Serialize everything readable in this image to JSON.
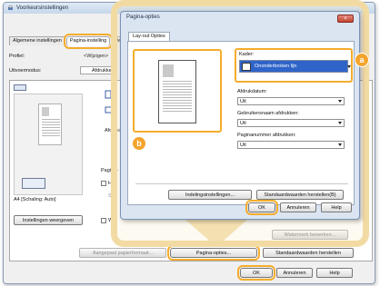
{
  "main_window": {
    "title": "Voorkeursinstellingen",
    "tabs": [
      "Algemene instellingen",
      "Pagina-instelling",
      "Twe"
    ],
    "profile_label": "Profiel:",
    "profile_edit": "<Wijzigen>",
    "output_label": "Uitvoermodus:",
    "output_value": "Afdrukken",
    "orientation_label": "Afdrukstand",
    "page_layout_label": "Pagina-",
    "checkbox_h": "Han",
    "checkbox_s": "Sch",
    "preview_caption": "A4 [Schaling: Auto]",
    "view_settings_button": "Instellingen weergeven",
    "watermark_checkbox": "Wat",
    "watermark_edit_button": "Watermerk bewerken...",
    "custom_paper_button": "Aangepast papierformaat...",
    "page_options_button": "Pagina-opties...",
    "restore_defaults_button": "Standaardwaarden herstellen",
    "ok_button": "OK",
    "cancel_button": "Annuleren",
    "help_button": "Help"
  },
  "dialog": {
    "title": "Pagina-opties",
    "close_symbol": "×",
    "tab": "Lay-out Opties",
    "frame_label": "Kader:",
    "frame_value": "Ononderbroken lijn",
    "print_date_label": "Afdrukdatum:",
    "print_date_value": "Uit",
    "print_username_label": "Gebruikersnaam afdrukken:",
    "print_username_value": "Uit",
    "page_numbers_label": "Paginanummer afdrukken:",
    "page_numbers_value": "Uit",
    "format_settings_button": "Indelingsinstellingen...",
    "restore_defaults_button": "Standaardwaarden herstellen(B)",
    "ok_button": "OK",
    "cancel_button": "Annuleren",
    "help_button": "Help"
  },
  "callouts": {
    "a": "a",
    "b": "b"
  },
  "colors": {
    "accent": "#f4ac2c",
    "selection": "#2f64c9"
  }
}
